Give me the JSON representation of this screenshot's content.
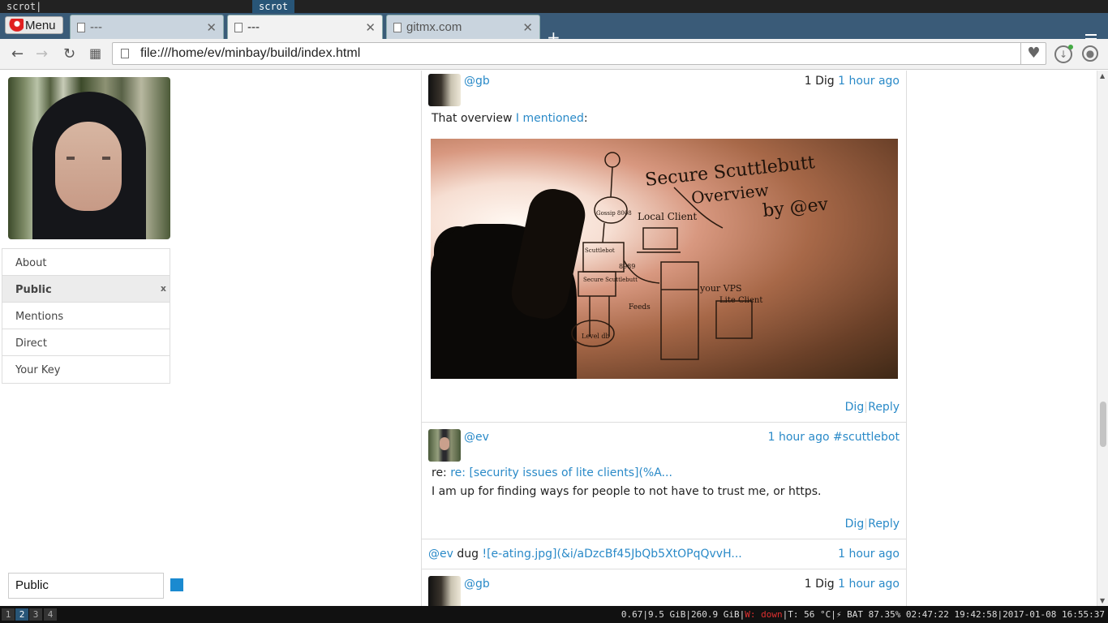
{
  "launcher": {
    "input": "scrot|",
    "selected": "scrot"
  },
  "browser": {
    "menu_label": "Menu",
    "tabs": [
      {
        "title": "---",
        "active": false
      },
      {
        "title": "---",
        "active": true
      },
      {
        "title": "gitmx.com",
        "active": false
      }
    ],
    "url": "file:///home/ev/minbay/build/index.html",
    "icons": [
      "back-icon",
      "forward-icon",
      "reload-icon",
      "speed-dial-icon",
      "page-icon",
      "heart-icon",
      "download-icon",
      "account-icon",
      "tab-menu-icon",
      "new-tab-icon"
    ]
  },
  "sidebar": {
    "items": [
      {
        "label": "About"
      },
      {
        "label": "Public",
        "active": true,
        "close": "x"
      },
      {
        "label": "Mentions"
      },
      {
        "label": "Direct"
      },
      {
        "label": "Your Key"
      }
    ],
    "compose_value": "Public",
    "accent_color": "#1a8ad0"
  },
  "posts": [
    {
      "author": "@gb",
      "digs": "1 Dig",
      "time": "1 hour ago",
      "text_prefix": "That overview",
      "link": "I mentioned",
      "text_suffix": ":",
      "image": {
        "title_line1": "Secure Scuttlebutt",
        "title_line2": "Overview",
        "title_line3": "by @ev",
        "labels": [
          "Local Client",
          "your VPS",
          "Lite Client",
          "Gossip 8008",
          "Scuttlebot",
          "Secure Scuttlebutt",
          "Feeds",
          "Level db",
          "8989"
        ]
      },
      "dig_label": "Dig",
      "reply_label": "Reply"
    },
    {
      "author": "@ev",
      "time": "1 hour ago",
      "channel": "#scuttlebot",
      "re_prefix": "re:",
      "re_link": "re: [security issues of lite clients](%A...",
      "text": "I am up for finding ways for people to not have to trust me, or https.",
      "dig_label": "Dig",
      "reply_label": "Reply"
    },
    {
      "author": "@ev",
      "verb": "dug",
      "target": "![e-ating.jpg](&i/aDzcBf45JbQb5XtOPqQvvH...",
      "time": "1 hour ago"
    },
    {
      "author": "@gb",
      "digs": "1 Dig",
      "time": "1 hour ago"
    }
  ],
  "statusbar": {
    "workspaces": [
      "1",
      "2",
      "3",
      "4"
    ],
    "active_workspace": "2",
    "load": "0.67",
    "mem": "9.5 GiB",
    "disk": "260.9 GiB",
    "wifi": "W: down",
    "temp": "T: 56 °C",
    "battery": "⚡ BAT 87.35% 02:47:22 19:42:58",
    "datetime": "2017-01-08 16:55:37"
  }
}
